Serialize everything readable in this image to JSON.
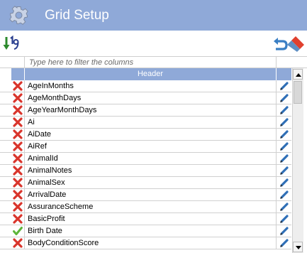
{
  "window": {
    "title": "Grid Setup",
    "title_icon": "gear-icon"
  },
  "toolbar": {
    "sort_icon": "sort-numeric-icon",
    "undo_icon": "undo-icon",
    "erase_icon": "eraser-icon"
  },
  "filter": {
    "placeholder": "Type here to filter the columns"
  },
  "table": {
    "header": "Header",
    "rows": [
      {
        "label": "AgeInMonths",
        "state": "excluded",
        "icon": "red-x-icon"
      },
      {
        "label": "AgeMonthDays",
        "state": "excluded",
        "icon": "red-x-icon"
      },
      {
        "label": "AgeYearMonthDays",
        "state": "excluded",
        "icon": "red-x-icon"
      },
      {
        "label": "Ai",
        "state": "excluded",
        "icon": "red-x-icon"
      },
      {
        "label": "AiDate",
        "state": "excluded",
        "icon": "red-x-icon"
      },
      {
        "label": "AiRef",
        "state": "excluded",
        "icon": "red-x-icon"
      },
      {
        "label": "AnimalId",
        "state": "excluded",
        "icon": "red-x-icon"
      },
      {
        "label": "AnimalNotes",
        "state": "excluded",
        "icon": "red-x-icon"
      },
      {
        "label": "AnimalSex",
        "state": "excluded",
        "icon": "red-x-icon"
      },
      {
        "label": "ArrivalDate",
        "state": "excluded",
        "icon": "red-x-icon"
      },
      {
        "label": "AssuranceScheme",
        "state": "excluded",
        "icon": "red-x-icon"
      },
      {
        "label": "BasicProfit",
        "state": "excluded",
        "icon": "red-x-icon"
      },
      {
        "label": "Birth Date",
        "state": "included",
        "icon": "green-check-icon"
      },
      {
        "label": "BodyConditionScore",
        "state": "excluded",
        "icon": "red-x-icon"
      }
    ],
    "edit_icon": "pencil-icon"
  },
  "colors": {
    "header_bg": "#8fa9d8",
    "excluded": "#d9342b",
    "included": "#5db53a"
  }
}
